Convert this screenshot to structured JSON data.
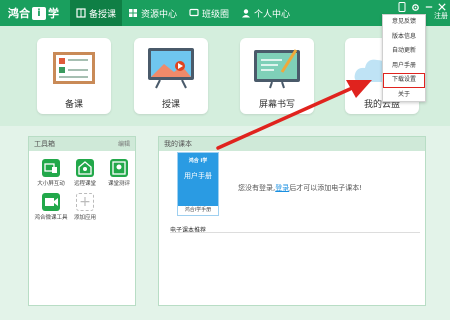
{
  "app": {
    "logo_part1": "鸿合",
    "logo_box": "i",
    "logo_part2": "学"
  },
  "nav": [
    {
      "label": "备授课",
      "active": true
    },
    {
      "label": "资源中心",
      "active": false
    },
    {
      "label": "班级圈",
      "active": false
    },
    {
      "label": "个人中心",
      "active": false
    }
  ],
  "header": {
    "login": "注册"
  },
  "tiles": [
    {
      "label": "备课"
    },
    {
      "label": "授课"
    },
    {
      "label": "屏幕书写"
    },
    {
      "label": "我的云盘"
    }
  ],
  "toolbox": {
    "title": "工具箱",
    "edit": "编辑",
    "tools": [
      {
        "label": "大小屏互动"
      },
      {
        "label": "远程课堂"
      },
      {
        "label": "课堂测评"
      },
      {
        "label": "鸿合微课工具"
      },
      {
        "label": "添加应用"
      }
    ]
  },
  "textbooks": {
    "title": "我的课本",
    "book_logo": "鸿合 i学",
    "book_title": "用户手册",
    "book_caption": "鸿合i学手册",
    "msg_before": "您没有登录,",
    "msg_link": "登录",
    "msg_after": "后才可以添加电子课本!",
    "recommend": "电子课本推荐"
  },
  "menu": {
    "items": [
      {
        "label": "意见反馈",
        "highlight": false
      },
      {
        "label": "版本信息",
        "highlight": false
      },
      {
        "label": "自动更新",
        "highlight": false
      },
      {
        "label": "用户手册",
        "highlight": false
      },
      {
        "label": "下载设置",
        "highlight": true
      },
      {
        "label": "关于",
        "highlight": false
      }
    ]
  },
  "colors": {
    "topbar": "#1a9f5e",
    "accent_red": "#e0231e",
    "tool_green": "#22a84a",
    "book_blue": "#2a9be3"
  }
}
